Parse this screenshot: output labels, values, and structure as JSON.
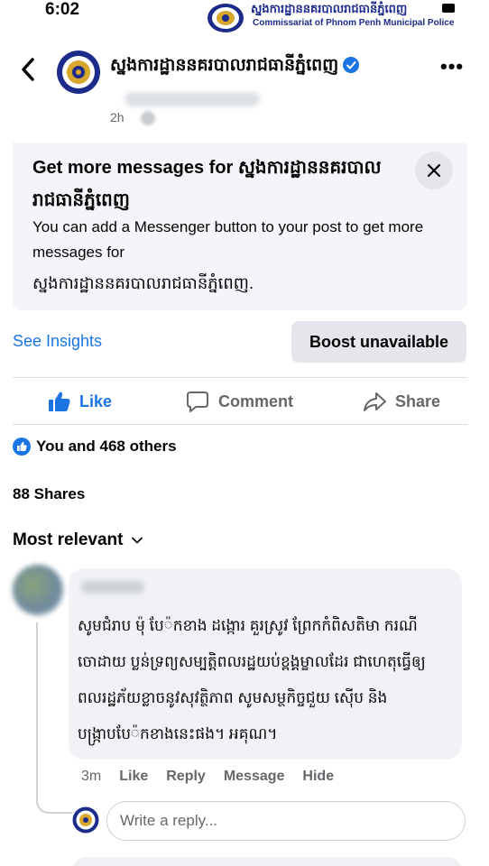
{
  "status_bar": {
    "time": "6:02"
  },
  "watermark": {
    "title_km": "ស្នងការដ្ឋាននគរបាលរាជធានីភ្នំពេញ",
    "title_en": "Commissariat of Phnom Penh Municipal Police"
  },
  "post": {
    "page_name": "ស្នងការដ្ឋាននគរបាលរាជធានីភ្នំពេញ",
    "time": "2h"
  },
  "promo": {
    "title_prefix": "Get more messages for",
    "title_page": "ស្នងការដ្ឋាននគរបាលរាជធានីភ្នំពេញ",
    "body_line": "You can add a Messenger button to your post to get more messages for",
    "body_page": "ស្នងការដ្ឋាននគរបាលរាជធានីភ្នំពេញ."
  },
  "insights": {
    "see_insights": "See Insights",
    "boost": "Boost unavailable"
  },
  "actions": {
    "like": "Like",
    "comment": "Comment",
    "share": "Share"
  },
  "reactions": {
    "text": "You and 468 others"
  },
  "shares": "88 Shares",
  "sort": {
    "label": "Most relevant"
  },
  "comment": {
    "text": "សូមជំរាប ម៉ុ បែ៉កខាង ដង្កោរ គួរស្រូវ ព្រែកកំពិសតិមា ករណី ចោដាយ ប្លន់ទ្រព្យសម្បត្តិពលរដ្ឋយប់ខ្ពង្គម្ខាលដែរ ជាហេតុធ្វើឲ្យពលរដ្ឋភ័យខ្លាចនូវសុវត្ថិភាព សូមសម្ថកិច្ចជួយ ស៊ើប និង បង្ក្រាបបែ៉កខាងនេះផង។ អគុណ។",
    "time": "3m",
    "like": "Like",
    "reply": "Reply",
    "message": "Message",
    "hide": "Hide"
  },
  "reply_box": {
    "placeholder": "Write a reply..."
  },
  "colors": {
    "accent": "#1b74e4",
    "secondary_text": "#65676b",
    "button_bg": "#e4e6eb",
    "card_bg": "#f3f5f8",
    "bubble_bg": "#f0f2f5"
  },
  "icons": {
    "back": "chevron-left-icon",
    "verified": "verified-badge-icon",
    "more": "more-horizontal-icon",
    "close": "close-icon",
    "like": "thumbs-up-icon",
    "comment": "comment-bubble-icon",
    "share": "share-arrow-icon",
    "sort": "chevron-down-icon"
  }
}
